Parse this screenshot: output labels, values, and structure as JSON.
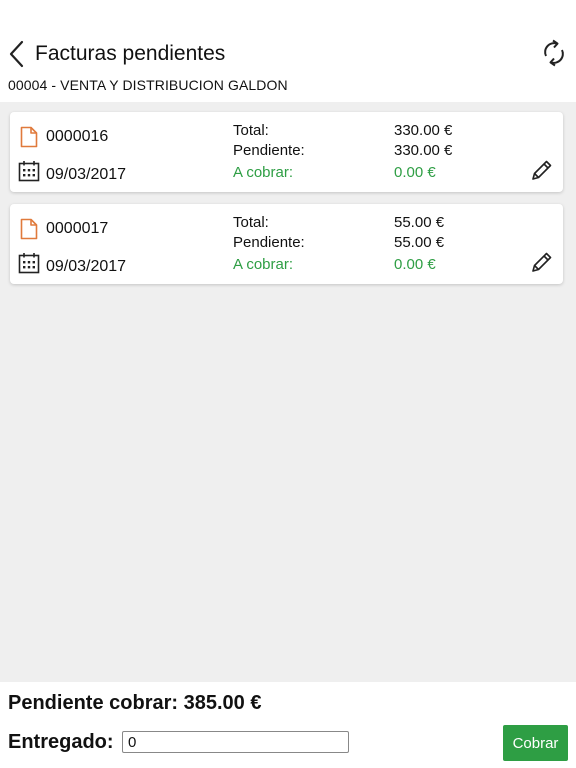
{
  "header": {
    "title": "Facturas pendientes",
    "subtitle": "00004 - VENTA Y DISTRIBUCION GALDON",
    "back_icon": "chevron-left-icon",
    "sync_icon": "sync-icon"
  },
  "labels": {
    "total": "Total:",
    "pendiente": "Pendiente:",
    "a_cobrar": "A cobrar:"
  },
  "invoices": [
    {
      "number": "0000016",
      "date": "09/03/2017",
      "total": "330.00 €",
      "pendiente": "330.00 €",
      "a_cobrar": "0.00 €"
    },
    {
      "number": "0000017",
      "date": "09/03/2017",
      "total": "55.00 €",
      "pendiente": "55.00 €",
      "a_cobrar": "0.00 €"
    }
  ],
  "footer": {
    "pendiente_cobrar": "Pendiente cobrar: 385.00 €",
    "entregado_label": "Entregado:",
    "entregado_value": "0",
    "cobrar_label": "Cobrar"
  },
  "colors": {
    "accent_green": "#2e9e44",
    "doc_icon_orange": "#e07a3c",
    "list_background": "#efefef"
  }
}
